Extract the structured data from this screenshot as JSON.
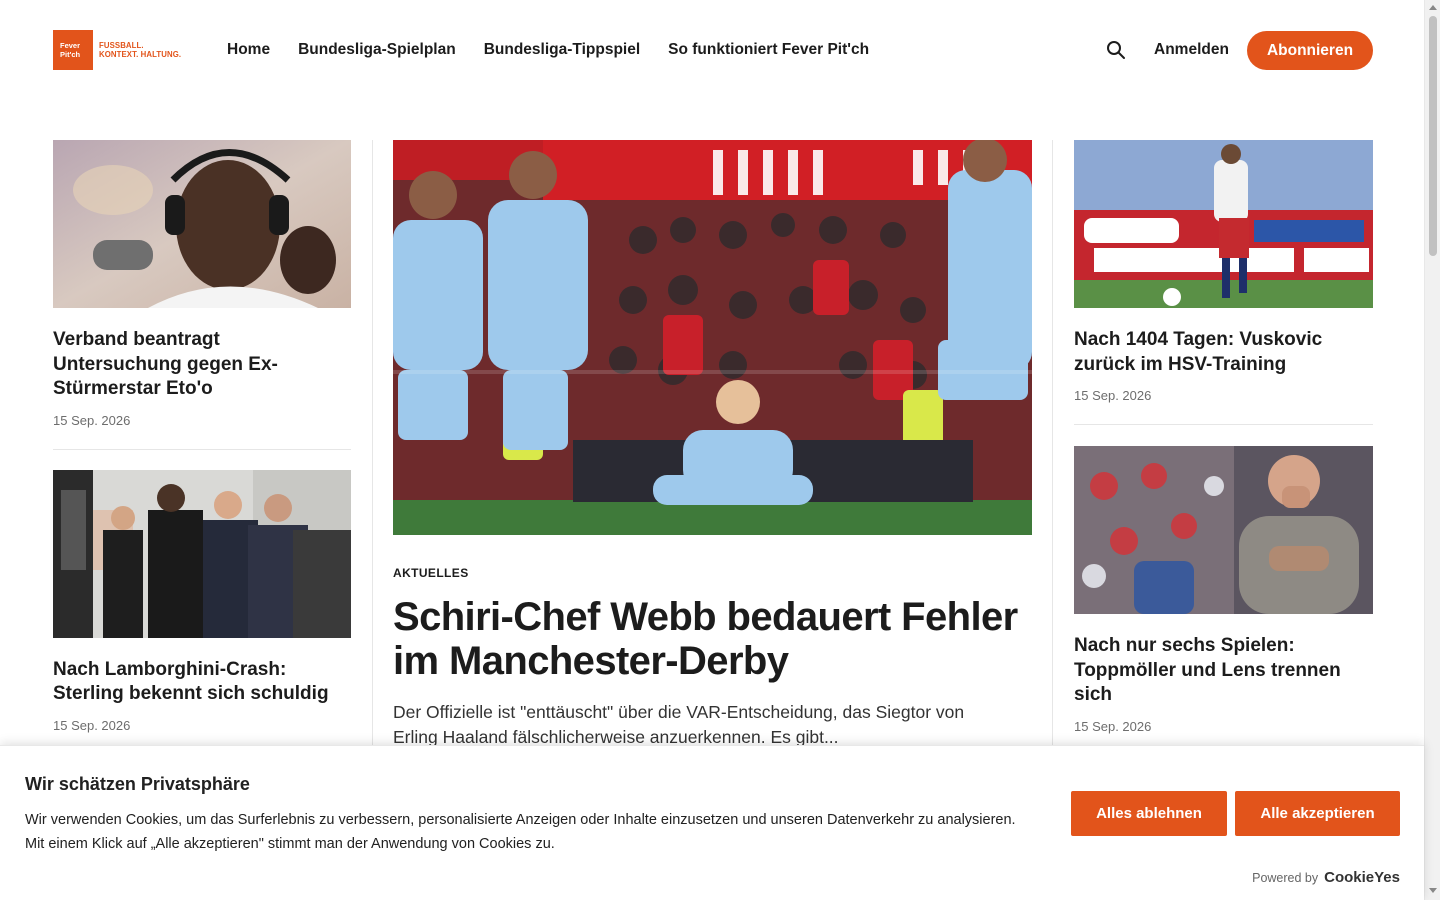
{
  "brand": {
    "logo_line1": "Fever",
    "logo_line2": "Pit'ch",
    "tag_line1": "FUSSBALL.",
    "tag_line2": "KONTEXT. HALTUNG.",
    "accent_color": "#e2541b"
  },
  "nav": {
    "items": [
      {
        "label": "Home"
      },
      {
        "label": "Bundesliga-Spielplan"
      },
      {
        "label": "Bundesliga-Tippspiel"
      },
      {
        "label": "So funktioniert Fever Pit'ch"
      }
    ],
    "search_icon": "search-icon",
    "login_label": "Anmelden",
    "subscribe_label": "Abonnieren"
  },
  "left_articles": [
    {
      "title": "Verband beantragt Untersuchung gegen Ex-Stürmerstar Eto'o",
      "date": "15 Sep. 2026"
    },
    {
      "title": "Nach Lamborghini-Crash: Sterling bekennt sich schuldig",
      "date": "15 Sep. 2026"
    }
  ],
  "main_article": {
    "kicker": "AKTUELLES",
    "title": "Schiri-Chef Webb bedauert Fehler im Manchester-Derby",
    "teaser": "Der Offizielle ist \"enttäuscht\" über die VAR-Entscheidung, das Siegtor von Erling Haaland fälschlicherweise anzuerkennen. Es gibt..."
  },
  "right_articles": [
    {
      "title": "Nach 1404 Tagen: Vuskovic zurück im HSV-Training",
      "date": "15 Sep. 2026"
    },
    {
      "title": "Nach nur sechs Spielen: Toppmöller und Lens trennen sich",
      "date": "15 Sep. 2026"
    }
  ],
  "cookie": {
    "title": "Wir schätzen Privatsphäre",
    "text_line1": "Wir verwenden Cookies, um das Surferlebnis zu verbessern, personalisierte Anzeigen oder Inhalte einzusetzen und unseren Datenverkehr zu analysieren.",
    "text_line2": "Mit einem Klick auf „Alle akzeptieren\" stimmt man der Anwendung von Cookies zu.",
    "reject_label": "Alles ablehnen",
    "accept_label": "Alle akzeptieren",
    "powered_by": "Powered by",
    "powered_brand": "CookieYes"
  }
}
